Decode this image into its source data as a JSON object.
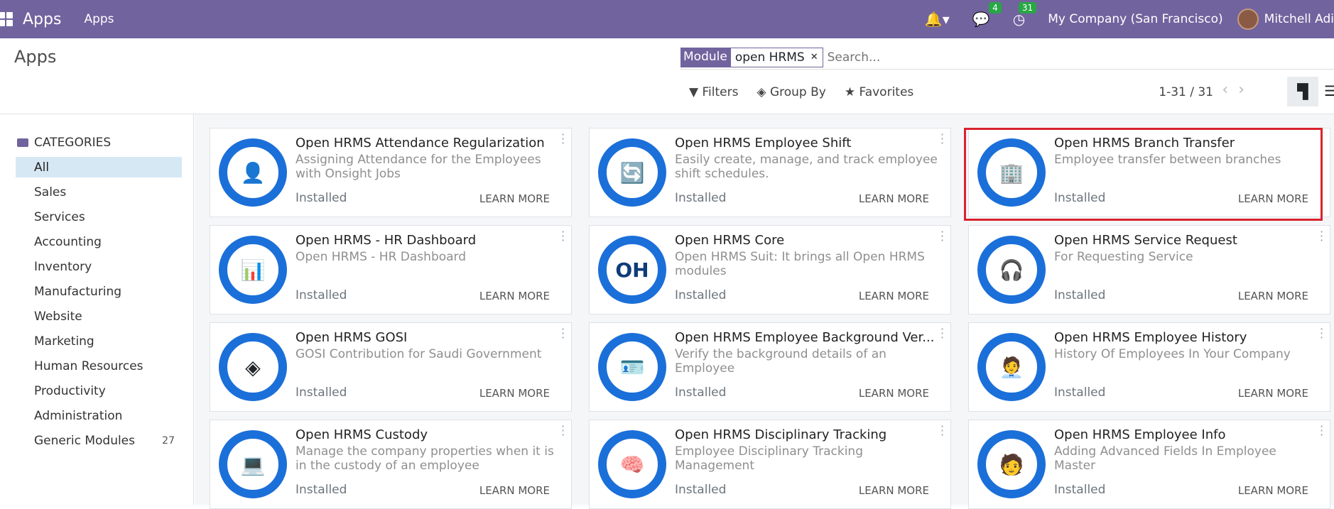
{
  "nav": {
    "brand": "Apps",
    "menu": "Apps",
    "messages_count": "4",
    "activities_count": "31",
    "company": "My Company (San Francisco)",
    "user": "Mitchell Adi"
  },
  "control": {
    "title": "Apps",
    "facet_label": "Module",
    "facet_value": "open HRMS",
    "search_placeholder": "Search...",
    "filters": "Filters",
    "group_by": "Group By",
    "favorites": "Favorites",
    "pager": "1-31 / 31"
  },
  "sidebar": {
    "heading": "CATEGORIES",
    "items": [
      {
        "label": "All",
        "count": ""
      },
      {
        "label": "Sales",
        "count": ""
      },
      {
        "label": "Services",
        "count": ""
      },
      {
        "label": "Accounting",
        "count": ""
      },
      {
        "label": "Inventory",
        "count": ""
      },
      {
        "label": "Manufacturing",
        "count": ""
      },
      {
        "label": "Website",
        "count": ""
      },
      {
        "label": "Marketing",
        "count": ""
      },
      {
        "label": "Human Resources",
        "count": ""
      },
      {
        "label": "Productivity",
        "count": ""
      },
      {
        "label": "Administration",
        "count": ""
      },
      {
        "label": "Generic Modules",
        "count": "27"
      }
    ]
  },
  "cards": [
    {
      "title": "Open HRMS Attendance Regularization",
      "desc": "Assigning Attendance for the Employees with Onsight Jobs",
      "status": "Installed",
      "action": "LEARN MORE",
      "icon": "👤"
    },
    {
      "title": "Open HRMS Employee Shift",
      "desc": "Easily create, manage, and track employee shift schedules.",
      "status": "Installed",
      "action": "LEARN MORE",
      "icon": "🔄"
    },
    {
      "title": "Open HRMS Branch Transfer",
      "desc": "Employee transfer between branches",
      "status": "Installed",
      "action": "LEARN MORE",
      "icon": "🏢"
    },
    {
      "title": "Open HRMS - HR Dashboard",
      "desc": "Open HRMS - HR Dashboard",
      "status": "Installed",
      "action": "LEARN MORE",
      "icon": "📊"
    },
    {
      "title": "Open HRMS Core",
      "desc": "Open HRMS Suit: It brings all Open HRMS modules",
      "status": "Installed",
      "action": "LEARN MORE",
      "icon": "OH"
    },
    {
      "title": "Open HRMS Service Request",
      "desc": "For Requesting Service",
      "status": "Installed",
      "action": "LEARN MORE",
      "icon": "🎧"
    },
    {
      "title": "Open HRMS GOSI",
      "desc": "GOSI Contribution for Saudi Government",
      "status": "Installed",
      "action": "LEARN MORE",
      "icon": "◈"
    },
    {
      "title": "Open HRMS Employee Background Ver...",
      "desc": "Verify the background details of an Employee",
      "status": "Installed",
      "action": "LEARN MORE",
      "icon": "🪪"
    },
    {
      "title": "Open HRMS Employee History",
      "desc": "History Of Employees In Your Company",
      "status": "Installed",
      "action": "LEARN MORE",
      "icon": "🧑‍💼"
    },
    {
      "title": "Open HRMS Custody",
      "desc": "Manage the company properties when it is in the custody of an employee",
      "status": "Installed",
      "action": "LEARN MORE",
      "icon": "💻"
    },
    {
      "title": "Open HRMS Disciplinary Tracking",
      "desc": "Employee Disciplinary Tracking Management",
      "status": "Installed",
      "action": "LEARN MORE",
      "icon": "🧠"
    },
    {
      "title": "Open HRMS Employee Info",
      "desc": "Adding Advanced Fields In Employee Master",
      "status": "Installed",
      "action": "LEARN MORE",
      "icon": "🧑"
    }
  ]
}
